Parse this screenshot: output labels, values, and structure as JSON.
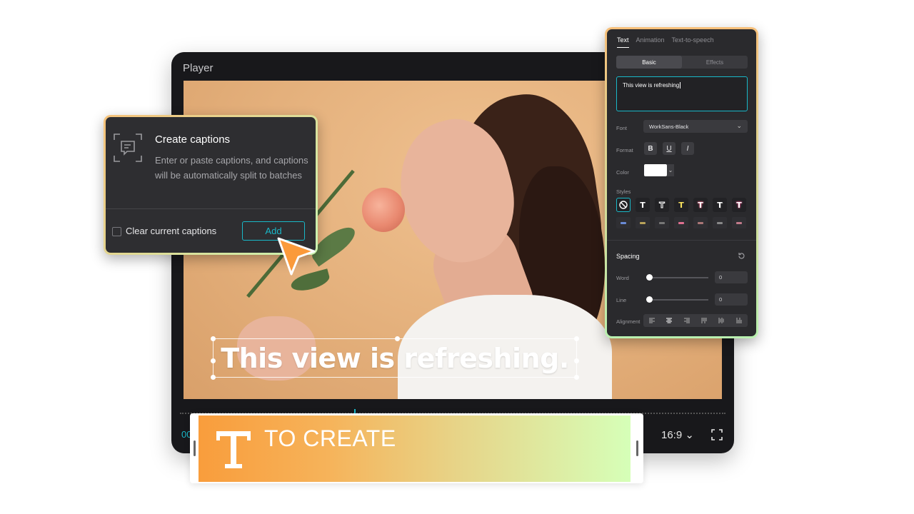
{
  "player": {
    "title": "Player",
    "caption": "This view is refreshing.",
    "time": "00",
    "ratio": "16:9",
    "ratio_chevron": "⌄"
  },
  "track": {
    "label": "TO CREATE",
    "icon": "text-t-icon"
  },
  "captions_popup": {
    "title": "Create captions",
    "description": "Enter or paste captions, and captions will be automatically split to batches",
    "checkbox_label": "Clear current captions",
    "checkbox_checked": false,
    "add_label": "Add",
    "accent": "#19b8c8"
  },
  "panel": {
    "tabs": [
      {
        "label": "Text",
        "active": true
      },
      {
        "label": "Animation",
        "active": false
      },
      {
        "label": "Text-to-speech",
        "active": false
      }
    ],
    "segments": [
      {
        "label": "Basic",
        "active": true
      },
      {
        "label": "Effects",
        "active": false
      }
    ],
    "text_value": "This view is refreshing",
    "font_label": "Font",
    "font_value": "WorkSans-Black",
    "format_label": "Format",
    "format_buttons": [
      "B",
      "U",
      "I"
    ],
    "color_label": "Color",
    "color_value": "#ffffff",
    "styles_label": "Styles",
    "style_glyph": "T",
    "spacing_label": "Spacing",
    "word_label": "Word",
    "word_value": "0",
    "line_label": "Line",
    "line_value": "0",
    "alignment_label": "Alignment"
  }
}
